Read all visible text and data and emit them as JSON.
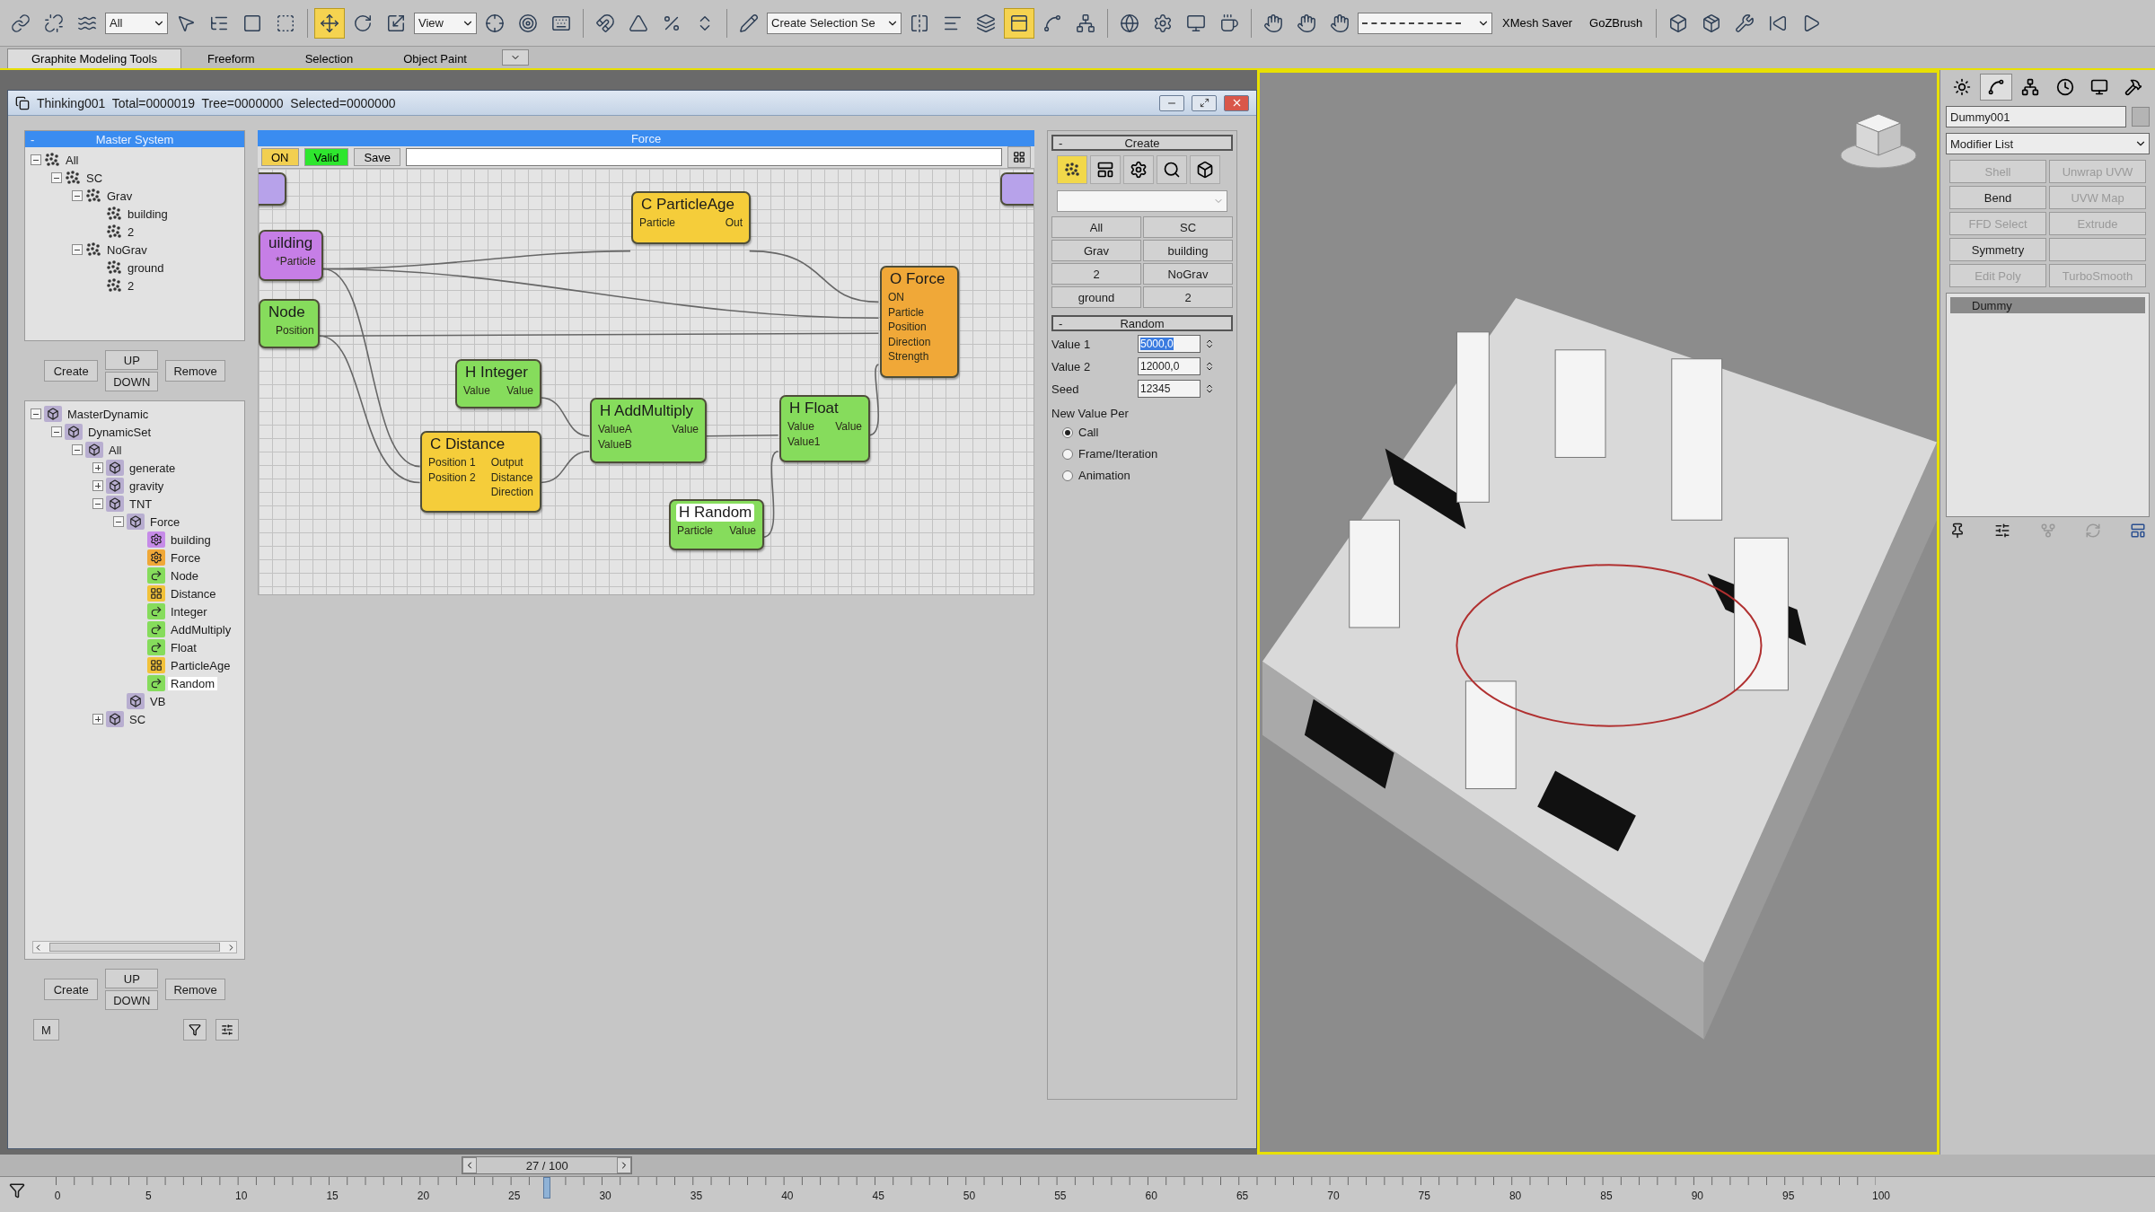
{
  "toolbar": {
    "items": [
      {
        "kind": "icon",
        "selected": false
      },
      {
        "kind": "icon",
        "selected": false
      },
      {
        "kind": "icon",
        "selected": false
      },
      {
        "kind": "dropdown",
        "value": "All"
      },
      {
        "kind": "icon",
        "selected": false
      },
      {
        "kind": "icon",
        "selected": false
      },
      {
        "kind": "icon",
        "selected": false
      },
      {
        "kind": "icon",
        "selected": false
      },
      {
        "kind": "separator"
      },
      {
        "kind": "icon",
        "selected": true
      },
      {
        "kind": "icon",
        "selected": false
      },
      {
        "kind": "icon",
        "selected": false
      },
      {
        "kind": "dropdown",
        "value": "View"
      },
      {
        "kind": "icon",
        "selected": false
      },
      {
        "kind": "icon",
        "selected": false
      },
      {
        "kind": "icon",
        "selected": false
      },
      {
        "kind": "separator"
      },
      {
        "kind": "icon",
        "selected": false
      },
      {
        "kind": "icon",
        "selected": false
      },
      {
        "kind": "icon",
        "selected": false
      },
      {
        "kind": "icon",
        "selected": false
      },
      {
        "kind": "separator"
      },
      {
        "kind": "icon",
        "selected": false
      },
      {
        "kind": "dropdown",
        "value": "Create Selection Se"
      },
      {
        "kind": "icon",
        "selected": false
      },
      {
        "kind": "icon",
        "selected": false
      },
      {
        "kind": "icon",
        "selected": false
      },
      {
        "kind": "icon",
        "selected": true
      },
      {
        "kind": "icon",
        "selected": false
      },
      {
        "kind": "icon",
        "selected": false
      },
      {
        "kind": "separator"
      },
      {
        "kind": "icon",
        "selected": false
      },
      {
        "kind": "icon",
        "selected": false
      },
      {
        "kind": "icon",
        "selected": false
      },
      {
        "kind": "icon",
        "selected": false
      },
      {
        "kind": "separator"
      },
      {
        "kind": "icon",
        "selected": false
      },
      {
        "kind": "icon",
        "selected": false
      },
      {
        "kind": "icon",
        "selected": false
      },
      {
        "kind": "line_dropdown"
      },
      {
        "kind": "button",
        "label": "XMesh Saver"
      },
      {
        "kind": "button",
        "label": "GoZBrush"
      },
      {
        "kind": "separator"
      },
      {
        "kind": "icon",
        "selected": false
      },
      {
        "kind": "icon",
        "selected": false
      },
      {
        "kind": "icon",
        "selected": false
      },
      {
        "kind": "icon",
        "selected": false
      },
      {
        "kind": "icon",
        "selected": false
      }
    ]
  },
  "ribbon_tabs": [
    {
      "label": "Graphite Modeling Tools",
      "selected": true
    },
    {
      "label": "Freeform",
      "selected": false
    },
    {
      "label": "Selection",
      "selected": false
    },
    {
      "label": "Object Paint",
      "selected": false
    }
  ],
  "dialog": {
    "title": "Thinking001  Total=0000019  Tree=0000000  Selected=0000000",
    "master_system": {
      "toggle": "-",
      "title": "Master System",
      "tree": [
        {
          "label": "All",
          "expanded": true,
          "children": [
            {
              "label": "SC",
              "expanded": true,
              "children": [
                {
                  "label": "Grav",
                  "expanded": true,
                  "children": [
                    {
                      "label": "building"
                    },
                    {
                      "label": "2"
                    }
                  ]
                },
                {
                  "label": "NoGrav",
                  "expanded": true,
                  "children": [
                    {
                      "label": "ground"
                    },
                    {
                      "label": "2"
                    }
                  ]
                }
              ]
            }
          ]
        }
      ]
    },
    "master_buttons": {
      "create": "Create",
      "up": "UP",
      "down": "DOWN",
      "remove": "Remove"
    },
    "dynamic_tree": [
      {
        "label": "MasterDynamic",
        "kind": "group",
        "selected": false,
        "expanded": true,
        "children": [
          {
            "label": "DynamicSet",
            "kind": "group",
            "selected": false,
            "expanded": true,
            "children": [
              {
                "label": "All",
                "kind": "group",
                "selected": false,
                "expanded": true,
                "children": [
                  {
                    "label": "generate",
                    "kind": "group",
                    "selected": false,
                    "expanded": false
                  },
                  {
                    "label": "gravity",
                    "kind": "group",
                    "selected": false,
                    "expanded": false
                  },
                  {
                    "label": "TNT",
                    "kind": "group",
                    "selected": false,
                    "expanded": true,
                    "children": [
                      {
                        "label": "Force",
                        "kind": "group",
                        "selected": false,
                        "expanded": true,
                        "children": [
                          {
                            "label": "building",
                            "kind": "operator",
                            "color": "#c68be8",
                            "selected": false
                          },
                          {
                            "label": "Force",
                            "kind": "operator",
                            "color": "#f0a838",
                            "selected": false
                          },
                          {
                            "label": "Node",
                            "kind": "helper",
                            "color": "#86dc5c",
                            "selected": false
                          },
                          {
                            "label": "Distance",
                            "kind": "condition",
                            "color": "#f2c23a",
                            "selected": false
                          },
                          {
                            "label": "Integer",
                            "kind": "helper",
                            "color": "#86dc5c",
                            "selected": false
                          },
                          {
                            "label": "AddMultiply",
                            "kind": "helper",
                            "color": "#86dc5c",
                            "selected": false
                          },
                          {
                            "label": "Float",
                            "kind": "helper",
                            "color": "#86dc5c",
                            "selected": false
                          },
                          {
                            "label": "ParticleAge",
                            "kind": "condition",
                            "color": "#f2c23a",
                            "selected": false
                          },
                          {
                            "label": "Random",
                            "kind": "helper",
                            "color": "#86dc5c",
                            "selected": true
                          }
                        ]
                      },
                      {
                        "label": "VB",
                        "kind": "group",
                        "selected": false
                      }
                    ]
                  },
                  {
                    "label": "SC",
                    "kind": "group",
                    "selected": false,
                    "expanded": false
                  }
                ]
              }
            ]
          }
        ]
      }
    ],
    "dynamic_buttons": {
      "create": "Create",
      "up": "UP",
      "down": "DOWN",
      "remove": "Remove"
    },
    "m_button": "M",
    "graph": {
      "title": "Force",
      "on": "ON",
      "valid": "Valid",
      "save": "Save",
      "nodes": [
        {
          "kind": "stub"
        },
        {
          "kind": "stub"
        },
        {
          "kind": "group",
          "title": "uilding",
          "outputs": [
            "*Particle"
          ],
          "selected": false
        },
        {
          "kind": "helper",
          "title": "Node",
          "outputs": [
            "Position"
          ],
          "selected": false
        },
        {
          "kind": "condition",
          "title": "C ParticleAge",
          "inputs": [
            "Particle"
          ],
          "outputs": [
            "Out"
          ],
          "selected": false
        },
        {
          "kind": "operator",
          "title": "O Force",
          "inputs": [
            "ON",
            "Particle",
            "Position",
            "Direction",
            "Strength"
          ],
          "selected": false
        },
        {
          "kind": "helper",
          "title": "H Integer",
          "inputs": [
            "Value"
          ],
          "outputs": [
            "Value"
          ],
          "selected": false
        },
        {
          "kind": "condition",
          "title": "C Distance",
          "inputs": [
            "Position 1",
            "Position 2"
          ],
          "outputs": [
            "Output",
            "Distance",
            "Direction"
          ],
          "selected": false
        },
        {
          "kind": "helper",
          "title": "H AddMultiply",
          "inputs": [
            "ValueA",
            "ValueB"
          ],
          "outputs": [
            "Value"
          ],
          "selected": false
        },
        {
          "kind": "helper",
          "title": "H Float",
          "inputs": [
            "Value",
            "Value1"
          ],
          "outputs": [
            "Value"
          ],
          "selected": false
        },
        {
          "kind": "helper",
          "title": "H Random",
          "inputs": [
            "Particle"
          ],
          "outputs": [
            "Value"
          ],
          "selected": true
        }
      ]
    },
    "create": {
      "toggle": "-",
      "title": "Create",
      "tools": [
        {
          "selected": true
        },
        {
          "selected": false
        },
        {
          "selected": false
        },
        {
          "selected": false
        },
        {
          "selected": false
        }
      ],
      "sets": [
        "All",
        "SC",
        "Grav",
        "building",
        "2",
        "NoGrav",
        "ground",
        "2"
      ]
    },
    "random": {
      "toggle": "-",
      "title": "Random",
      "fields": [
        {
          "label": "Value 1",
          "value": "5000,0",
          "selected": true
        },
        {
          "label": "Value 2",
          "value": "12000,0",
          "selected": false
        },
        {
          "label": "Seed",
          "value": "12345",
          "selected": false
        }
      ],
      "new_value_label": "New Value Per",
      "options": [
        {
          "label": "Call",
          "selected": true
        },
        {
          "label": "Frame/Iteration",
          "selected": false
        },
        {
          "label": "Animation",
          "selected": false
        }
      ]
    }
  },
  "command_panel": {
    "tabs": [
      {
        "selected": false
      },
      {
        "selected": true
      },
      {
        "selected": false
      },
      {
        "selected": false
      },
      {
        "selected": false
      },
      {
        "selected": false
      }
    ],
    "object_name": "Dummy001",
    "modifier_list": "Modifier List",
    "modifier_buttons": [
      {
        "kind": "button",
        "label": "Shell",
        "disabled": true
      },
      {
        "kind": "button",
        "label": "Unwrap UVW",
        "disabled": true
      },
      {
        "kind": "button",
        "label": "Bend",
        "disabled": false
      },
      {
        "kind": "button",
        "label": "UVW Map",
        "disabled": true
      },
      {
        "kind": "button",
        "label": "FFD Select",
        "disabled": true
      },
      {
        "kind": "button",
        "label": "Extrude",
        "disabled": true
      },
      {
        "kind": "button",
        "label": "Symmetry",
        "disabled": false
      },
      {
        "kind": "blank"
      },
      {
        "kind": "button",
        "label": "Edit Poly",
        "disabled": true
      },
      {
        "kind": "button",
        "label": "TurboSmooth",
        "disabled": true
      }
    ],
    "stack": [
      {
        "label": "Dummy",
        "selected": true
      }
    ]
  },
  "timeline": {
    "position": "27 / 100",
    "level": 0.27,
    "frame_labels": [
      "0",
      "5",
      "10",
      "15",
      "20",
      "25",
      "30",
      "35",
      "40",
      "45",
      "50",
      "55",
      "60",
      "65",
      "70",
      "75",
      "80",
      "85",
      "90",
      "95",
      "100"
    ]
  }
}
